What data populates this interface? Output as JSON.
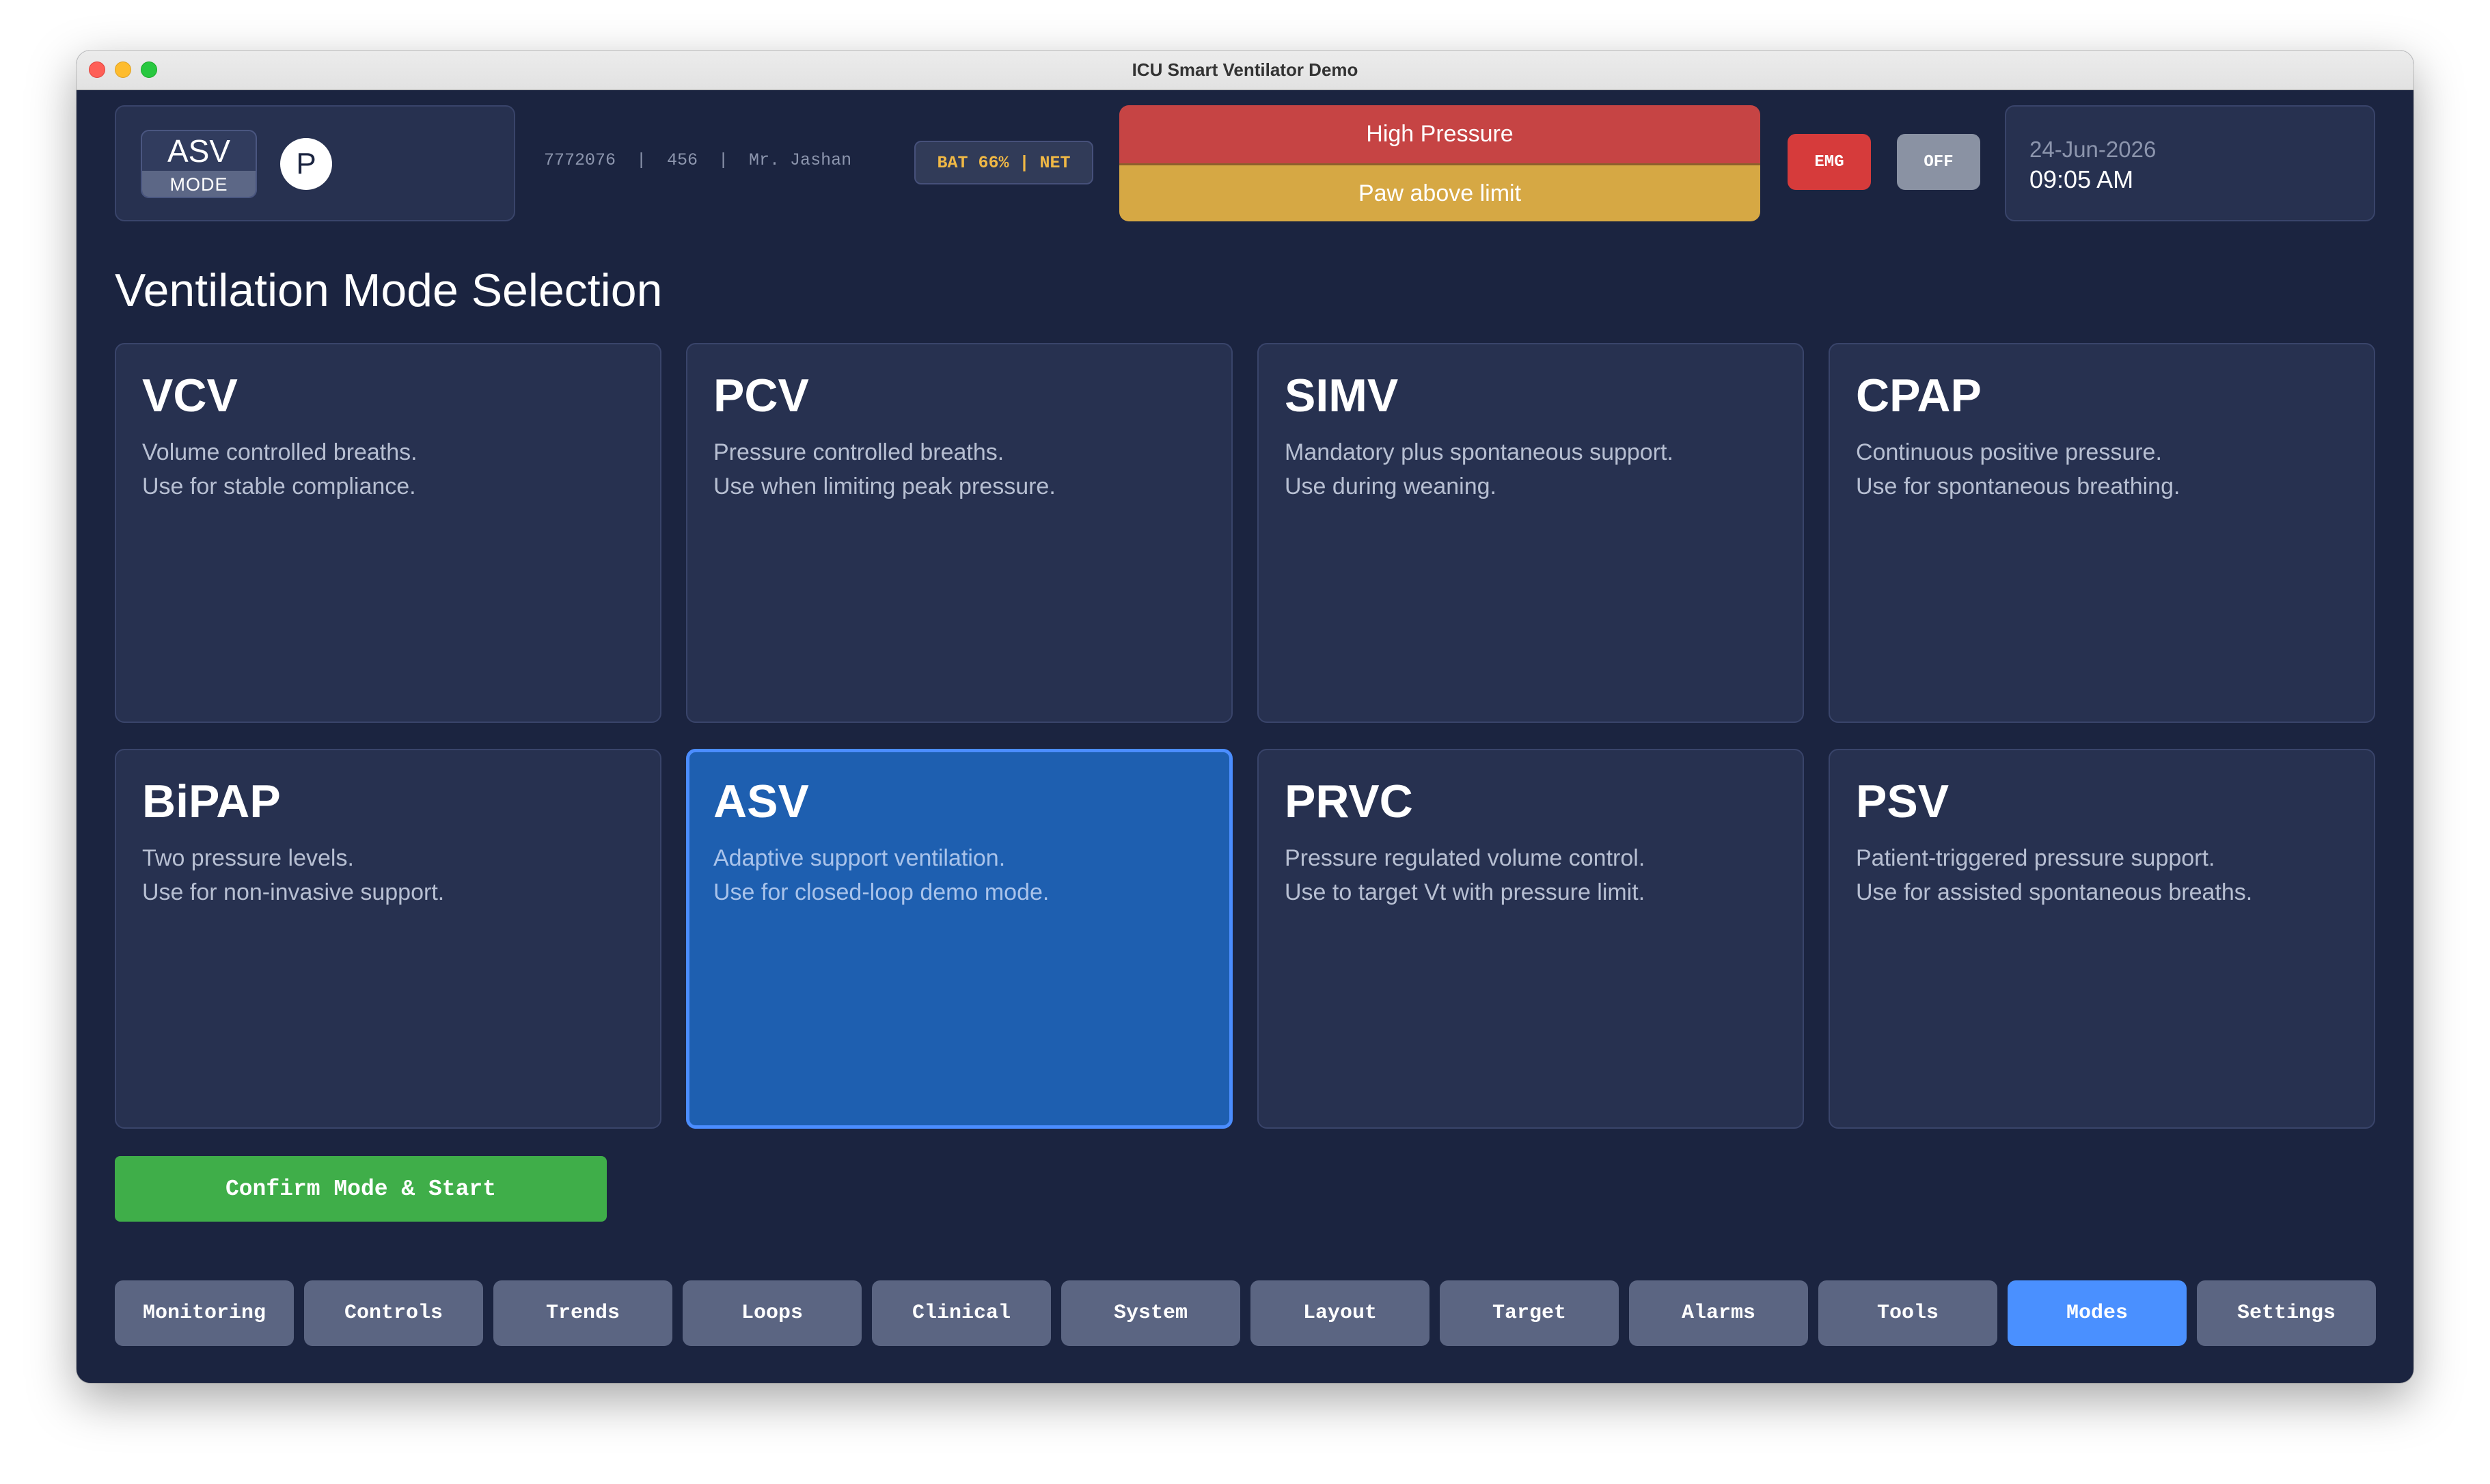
{
  "window": {
    "title": "ICU Smart Ventilator Demo"
  },
  "header": {
    "mode_badge": {
      "mode": "ASV",
      "label": "MODE"
    },
    "patient_avatar": "P",
    "patient_meta": "7772076  |  456  |  Mr. Jashan",
    "status_pill": "BAT 66% | NET",
    "alarms": {
      "primary": "High Pressure",
      "secondary": "Paw above limit"
    },
    "emg_label": "EMG",
    "off_label": "OFF",
    "date": "24-Jun-2026",
    "time": "09:05 AM"
  },
  "page_title": "Ventilation Mode Selection",
  "modes": [
    {
      "name": "VCV",
      "line1": "Volume controlled breaths.",
      "line2": "Use for stable compliance."
    },
    {
      "name": "PCV",
      "line1": "Pressure controlled breaths.",
      "line2": "Use when limiting peak pressure."
    },
    {
      "name": "SIMV",
      "line1": "Mandatory plus spontaneous support.",
      "line2": "Use during weaning."
    },
    {
      "name": "CPAP",
      "line1": "Continuous positive pressure.",
      "line2": "Use for spontaneous breathing."
    },
    {
      "name": "BiPAP",
      "line1": "Two pressure levels.",
      "line2": "Use for non-invasive support."
    },
    {
      "name": "ASV",
      "line1": "Adaptive support ventilation.",
      "line2": "Use for closed-loop demo mode."
    },
    {
      "name": "PRVC",
      "line1": "Pressure regulated volume control.",
      "line2": "Use to target Vt with pressure limit."
    },
    {
      "name": "PSV",
      "line1": "Patient-triggered pressure support.",
      "line2": "Use for assisted spontaneous breaths."
    }
  ],
  "selected_mode": "ASV",
  "confirm_label": "Confirm Mode & Start",
  "nav": {
    "active": "Modes",
    "tabs": [
      "Monitoring",
      "Controls",
      "Trends",
      "Loops",
      "Clinical",
      "System",
      "Layout",
      "Target",
      "Alarms",
      "Tools",
      "Modes",
      "Settings"
    ]
  },
  "colors": {
    "background": "#1b2440",
    "card": "#273150",
    "selected_tile": "#1e5fb0",
    "alarm_high": "#c64444",
    "alarm_medium": "#d6a844",
    "confirm": "#3fae49",
    "active_tab": "#4a90ff"
  }
}
